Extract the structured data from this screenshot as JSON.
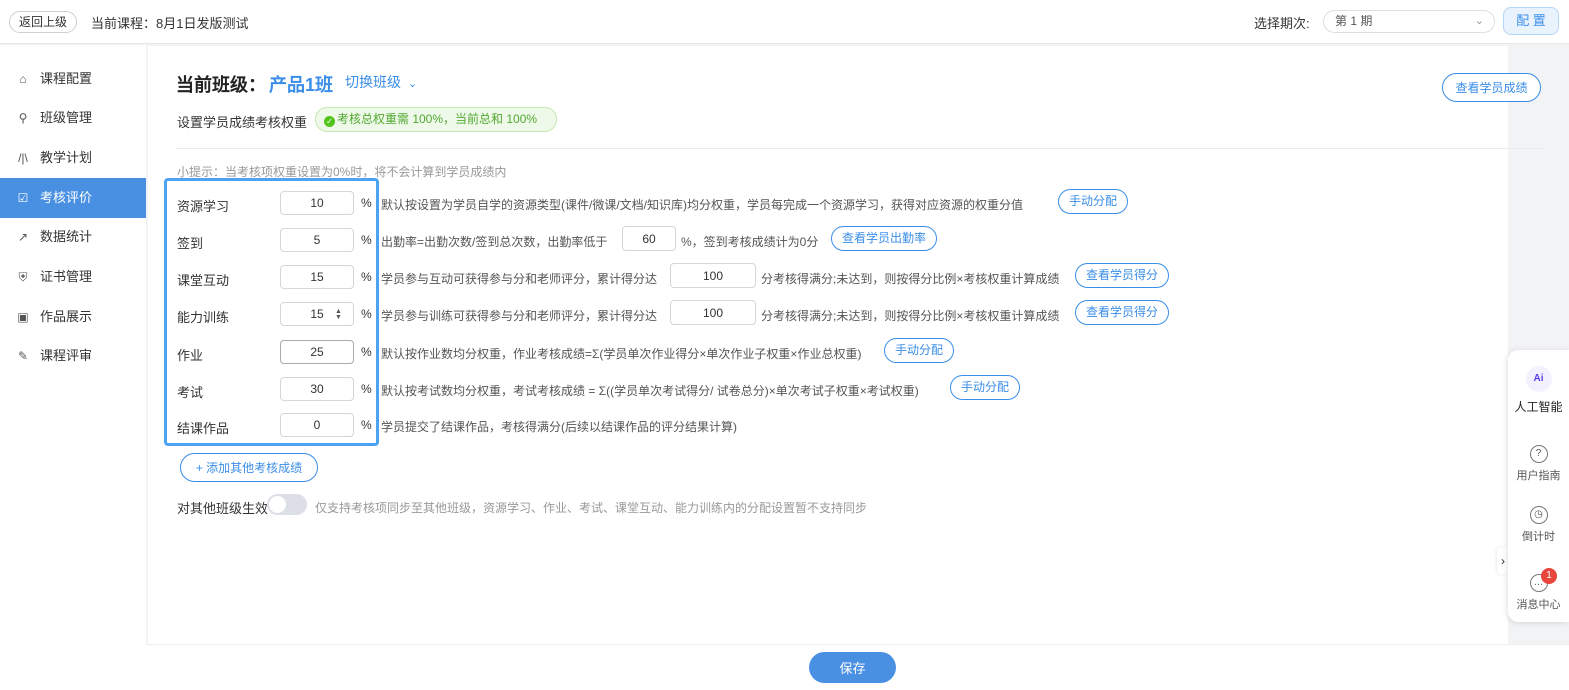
{
  "topbar": {
    "back_label": "返回上级",
    "course_label": "当前课程：8月1日发版测试",
    "period_label": "选择期次:",
    "period_value": "第 1 期",
    "config_label": "配 置"
  },
  "sidebar": {
    "items": [
      {
        "label": "课程配置",
        "icon": "home-icon"
      },
      {
        "label": "班级管理",
        "icon": "user-icon"
      },
      {
        "label": "教学计划",
        "icon": "books-icon"
      },
      {
        "label": "考核评价",
        "icon": "checkbox-icon",
        "active": true
      },
      {
        "label": "数据统计",
        "icon": "chart-icon"
      },
      {
        "label": "证书管理",
        "icon": "shield-icon"
      },
      {
        "label": "作品展示",
        "icon": "camera-icon"
      },
      {
        "label": "课程评审",
        "icon": "review-icon"
      }
    ]
  },
  "main": {
    "class_title": "当前班级：",
    "class_name": "产品1班",
    "switch_class": "切换班级",
    "view_scores": "查看学员成绩",
    "weight_label": "设置学员成绩考核权重",
    "weight_badge": "考核总权重需 100%，当前总和 100%",
    "tip": "小提示：当考核项权重设置为0%时，将不会计算到学员成绩内",
    "pct": "%",
    "items": [
      {
        "label": "资源学习",
        "value": "10",
        "desc": "默认按设置为学员自学的资源类型(课件/微课/文档/知识库)均分权重，学员每完成一个资源学习，获得对应资源的权重分值",
        "button": "手动分配"
      },
      {
        "label": "签到",
        "value": "5",
        "desc": "出勤率=出勤次数/签到总次数，出勤率低于",
        "inline_value": "60",
        "desc_tail": "%，签到考核成绩计为0分",
        "button": "查看学员出勤率"
      },
      {
        "label": "课堂互动",
        "value": "15",
        "desc": "学员参与互动可获得参与分和老师评分，累计得分达",
        "inline_value": "100",
        "desc_tail": "分考核得满分;未达到，则按得分比例×考核权重计算成绩",
        "button": "查看学员得分"
      },
      {
        "label": "能力训练",
        "value": "15",
        "desc": "学员参与训练可获得参与分和老师评分，累计得分达",
        "inline_value": "100",
        "desc_tail": "分考核得满分;未达到，则按得分比例×考核权重计算成绩",
        "button": "查看学员得分"
      },
      {
        "label": "作业",
        "value": "25",
        "desc": "默认按作业数均分权重，作业考核成绩=Σ(学员单次作业得分×单次作业子权重×作业总权重)",
        "button": "手动分配"
      },
      {
        "label": "考试",
        "value": "30",
        "desc": "默认按考试数均分权重，考试考核成绩 = Σ((学员单次考试得分/ 试卷总分)×单次考试子权重×考试权重)",
        "button": "手动分配"
      },
      {
        "label": "结课作品",
        "value": "0",
        "desc": "学员提交了结课作品，考核得满分(后续以结课作品的评分结果计算)"
      }
    ],
    "add_label": "+ 添加其他考核成绩",
    "apply_label": "对其他班级生效",
    "apply_note": "仅支持考核项同步至其他班级，资源学习、作业、考试、课堂互动、能力训练内的分配设置暂不支持同步",
    "save_label": "保存"
  },
  "float_panel": {
    "ai_label": "人工智能",
    "guide_label": "用户指南",
    "countdown_label": "倒计时",
    "message_label": "消息中心",
    "message_badge": "1"
  }
}
